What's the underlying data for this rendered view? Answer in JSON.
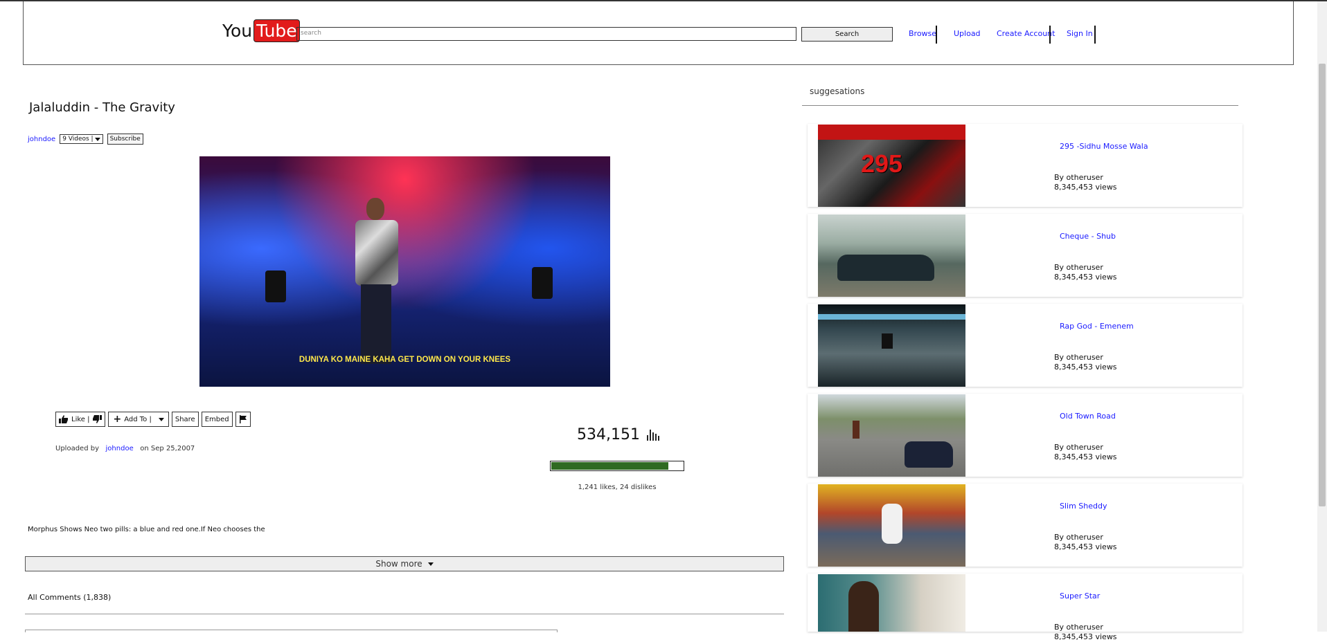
{
  "header": {
    "logo_you": "You",
    "logo_tube": "Tube",
    "search_placeholder": "search",
    "search_button": "Search",
    "nav": [
      {
        "label": "Browse"
      },
      {
        "label": "Upload"
      },
      {
        "label": "Create Account"
      },
      {
        "label": "Sign In"
      }
    ]
  },
  "video": {
    "title": "Jalaluddin - The Gravity",
    "channel": "johndoe",
    "videos_select": "9 Videos |",
    "subscribe": "Subscribe",
    "subtitle": "DUNIYA KO MAINE KAHA GET DOWN ON YOUR KNEES",
    "actions": {
      "like": "Like |",
      "add_to": "Add To |",
      "share": "Share",
      "embed": "Embed"
    },
    "uploaded_prefix": "Uploaded by",
    "uploader": "johndoe",
    "uploaded_date": "on Sep 25,2007",
    "views": "534,151",
    "like_ratio": 0.88,
    "likes_text": "1,241 likes, 24 dislikes",
    "description": "Morphus Shows Neo two pills: a blue and red one.If Neo chooses the",
    "show_more": "Show more",
    "comments_title": "All Comments (1,838)"
  },
  "suggestions": {
    "title": "suggesations",
    "items": [
      {
        "title": "295 -Sidhu Mosse Wala",
        "by": "By otheruser",
        "views": "8,345,453 views",
        "thumb_text": "295"
      },
      {
        "title": "Cheque - Shub",
        "by": "By otheruser",
        "views": "8,345,453 views"
      },
      {
        "title": "Rap God - Emenem",
        "by": "By otheruser",
        "views": "8,345,453 views"
      },
      {
        "title": "Old Town Road",
        "by": "By otheruser",
        "views": "8,345,453 views"
      },
      {
        "title": "Slim Sheddy",
        "by": "By otheruser",
        "views": "8,345,453 views"
      },
      {
        "title": "Super Star",
        "by": "By otheruser",
        "views": "8,345,453 views"
      }
    ]
  },
  "colors": {
    "logo_red": "#e21b1b",
    "like_bar_green": "#2f6a22",
    "link_blue": "#1a1aff"
  }
}
